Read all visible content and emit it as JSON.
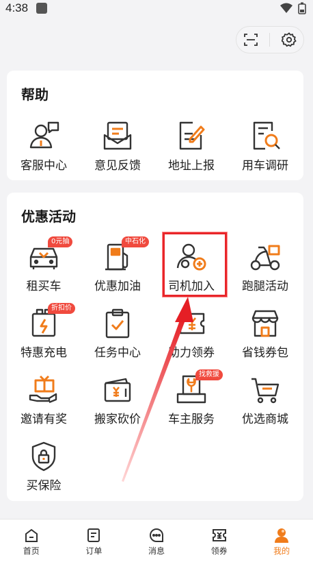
{
  "status": {
    "time": "4:38"
  },
  "help": {
    "title": "帮助",
    "items": [
      {
        "label": "客服中心"
      },
      {
        "label": "意见反馈"
      },
      {
        "label": "地址上报"
      },
      {
        "label": "用车调研"
      }
    ]
  },
  "promo": {
    "title": "优惠活动",
    "items": [
      {
        "label": "租买车",
        "badge": "0元抽"
      },
      {
        "label": "优惠加油",
        "badge": "中石化"
      },
      {
        "label": "司机加入"
      },
      {
        "label": "跑腿活动"
      },
      {
        "label": "特惠充电",
        "badge": "折扣价"
      },
      {
        "label": "任务中心"
      },
      {
        "label": "助力领券"
      },
      {
        "label": "省钱券包"
      },
      {
        "label": "邀请有奖"
      },
      {
        "label": "搬家砍价"
      },
      {
        "label": "车主服务",
        "badge": "找救援"
      },
      {
        "label": "优选商城"
      },
      {
        "label": "买保险"
      }
    ]
  },
  "nav": [
    {
      "label": "首页"
    },
    {
      "label": "订单"
    },
    {
      "label": "消息"
    },
    {
      "label": "领券"
    },
    {
      "label": "我的"
    }
  ],
  "colors": {
    "accent": "#f07c1b",
    "highlight": "#e8262a",
    "badge": "#f04a3e"
  }
}
